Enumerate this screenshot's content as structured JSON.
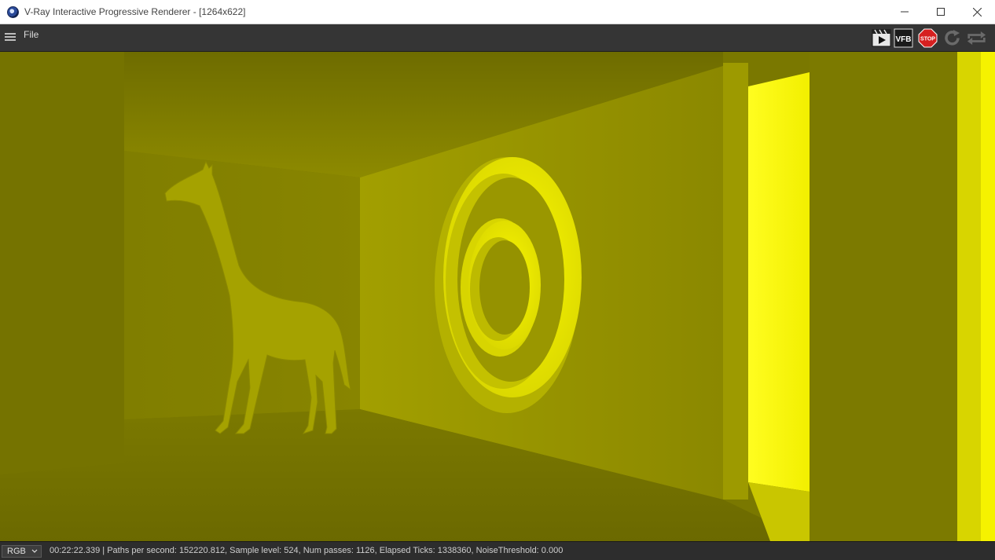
{
  "window": {
    "title": "V-Ray Interactive Progressive Renderer - [1264x622]",
    "icon": "vray-app-icon",
    "controls": [
      "minimize-icon",
      "maximize-icon",
      "close-icon"
    ]
  },
  "menubar": {
    "menu_icon": "hamburger-icon",
    "file_label": "File"
  },
  "toolbar": {
    "render_icon": "render-to-picture-viewer-icon",
    "vfb_label": "VFB",
    "stop_label": "STOP",
    "refresh_icon": "refresh-icon",
    "sync_icon": "sync-icon"
  },
  "viewport": {
    "scene": "render-image",
    "accent": "#f2ef00"
  },
  "statusbar": {
    "channel": "RGB",
    "elapsed": "00:22:22.339",
    "details": "Paths per second: 152220.812, Sample level: 524, Num passes: 1126, Elapsed Ticks: 1338360, NoiseThreshold: 0.000"
  }
}
